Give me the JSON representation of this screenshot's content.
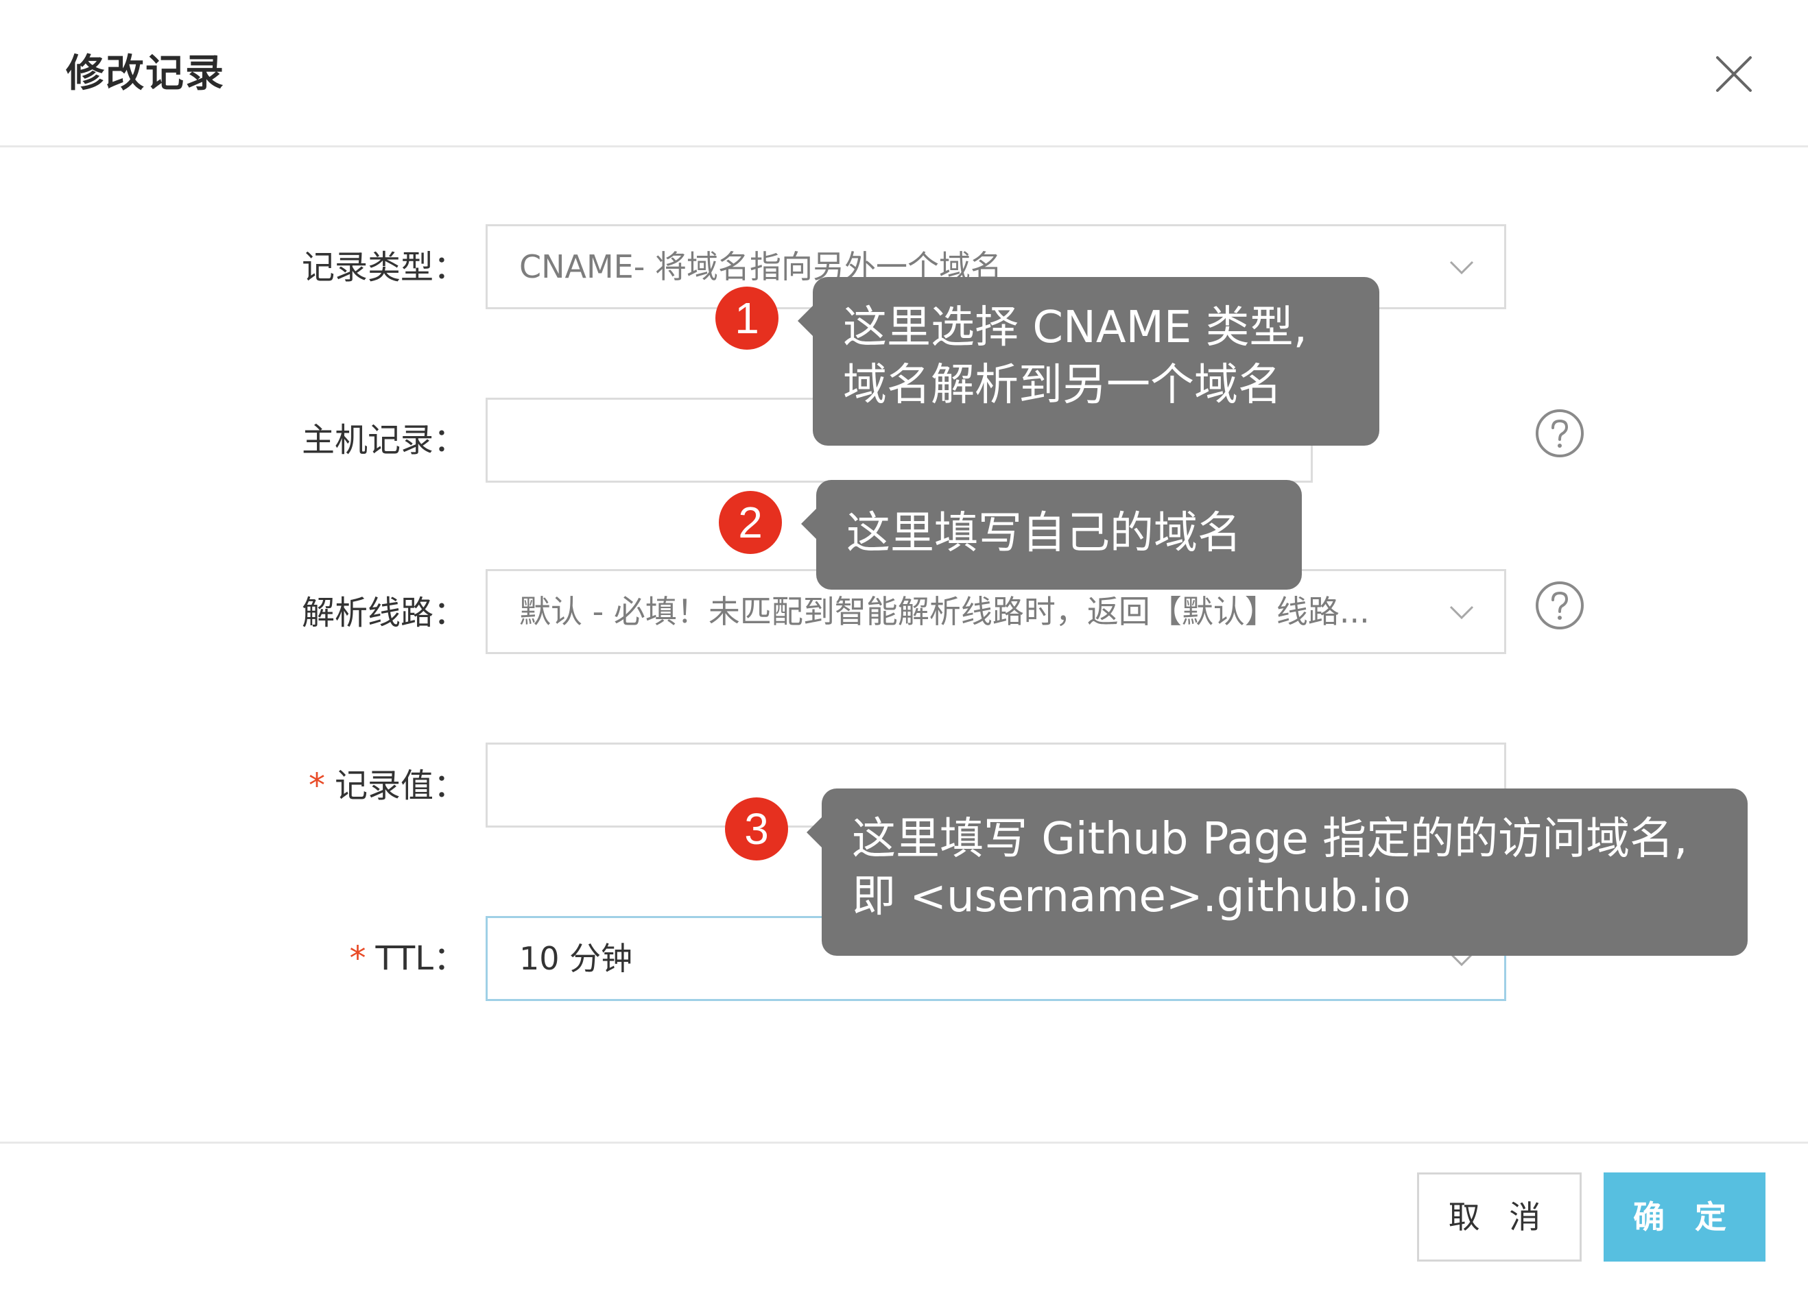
{
  "dialog": {
    "title": "修改记录",
    "close_icon": "close-icon"
  },
  "form": {
    "record_type": {
      "label": "记录类型：",
      "value": "CNAME- 将域名指向另外一个域名"
    },
    "host": {
      "label": "主机记录：",
      "value": ""
    },
    "line": {
      "label": "解析线路：",
      "value": "默认 - 必填！未匹配到智能解析线路时，返回【默认】线路..."
    },
    "record_value": {
      "required_mark": "*",
      "label": "记录值：",
      "value": ""
    },
    "ttl": {
      "required_mark": "*",
      "label": "TTL：",
      "value": "10 分钟"
    }
  },
  "buttons": {
    "cancel": "取 消",
    "confirm": "确 定"
  },
  "annotations": [
    {
      "number": "1",
      "lines": [
        "这里选择 CNAME 类型,",
        "域名解析到另一个域名"
      ]
    },
    {
      "number": "2",
      "lines": [
        "这里填写自己的域名"
      ]
    },
    {
      "number": "3",
      "lines": [
        "这里填写 Github Page 指定的的访问域名,",
        "即 <username>.github.io"
      ]
    }
  ],
  "colors": {
    "primary": "#57bfe0",
    "required": "#e84a26",
    "annotation_bg": "#757575",
    "annotation_badge": "#e6301f"
  }
}
